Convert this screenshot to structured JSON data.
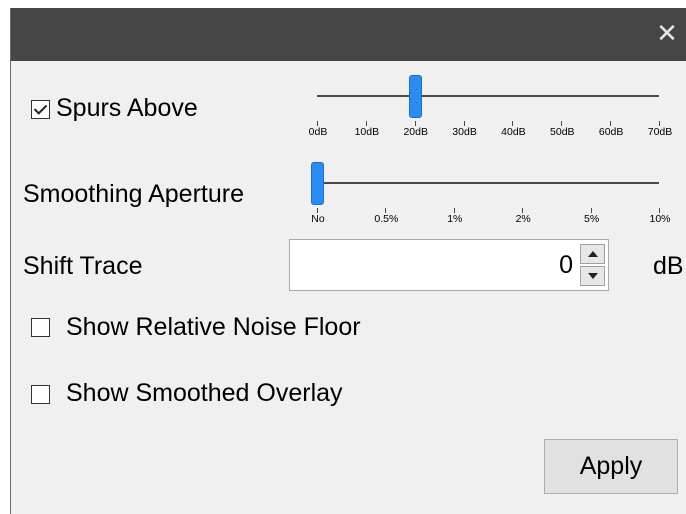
{
  "window": {
    "close_glyph": "✕"
  },
  "spurs_above": {
    "label": "Spurs Above",
    "checked": true,
    "slider": {
      "ticks": [
        "0dB",
        "10dB",
        "20dB",
        "30dB",
        "40dB",
        "50dB",
        "60dB",
        "70dB"
      ],
      "selected_index": 2,
      "selected_value": "20dB"
    }
  },
  "smoothing_aperture": {
    "label": "Smoothing Aperture",
    "slider": {
      "ticks": [
        "No",
        "0.5%",
        "1%",
        "2%",
        "5%",
        "10%"
      ],
      "selected_index": 0,
      "selected_value": "No"
    }
  },
  "shift_trace": {
    "label": "Shift Trace",
    "value": "0",
    "unit": "dB"
  },
  "show_relative_noise_floor": {
    "label": "Show Relative Noise Floor",
    "checked": false
  },
  "show_smoothed_overlay": {
    "label": "Show Smoothed Overlay",
    "checked": false
  },
  "apply_button": {
    "label": "Apply"
  },
  "colors": {
    "title_bar": "#464646",
    "dialog_bg": "#f0f0f0",
    "slider_thumb": "#2a8bf2"
  }
}
